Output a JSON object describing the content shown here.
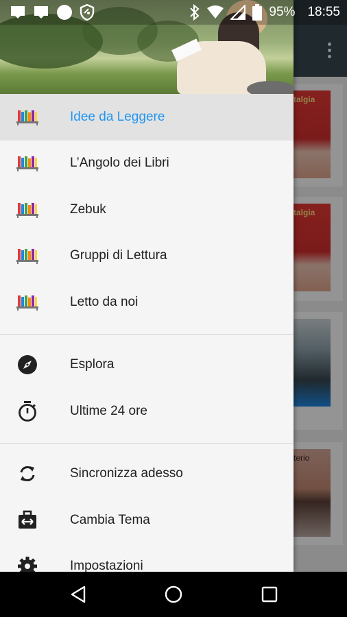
{
  "status_bar": {
    "battery": "95%",
    "time": "18:55",
    "icons": [
      "notification-icon",
      "notification-icon",
      "circle-icon",
      "shield-icon",
      "bluetooth-icon",
      "wifi-icon",
      "signal-icon",
      "battery-icon"
    ]
  },
  "background": {
    "covers": [
      {
        "text": "talgia",
        "style": "red"
      },
      {
        "text": "talgia",
        "style": "red"
      },
      {
        "text": "",
        "style": "blue"
      },
      {
        "text": "terio",
        "style": "brown"
      }
    ]
  },
  "drawer": {
    "feeds": [
      {
        "label": "Idee da Leggere",
        "icon": "bookshelf-icon",
        "active": true
      },
      {
        "label": "L’Angolo dei Libri",
        "icon": "bookshelf-icon",
        "active": false
      },
      {
        "label": "Zebuk",
        "icon": "bookshelf-icon",
        "active": false
      },
      {
        "label": "Gruppi di Lettura",
        "icon": "bookshelf-icon",
        "active": false
      },
      {
        "label": "Letto da noi",
        "icon": "bookshelf-icon",
        "active": false
      }
    ],
    "browse": [
      {
        "label": "Esplora",
        "icon": "compass-icon"
      },
      {
        "label": "Ultime 24 ore",
        "icon": "stopwatch-icon"
      }
    ],
    "actions": [
      {
        "label": "Sincronizza adesso",
        "icon": "sync-icon"
      },
      {
        "label": "Cambia Tema",
        "icon": "theme-swap-icon"
      },
      {
        "label": "Impostazioni",
        "icon": "gear-icon"
      }
    ]
  },
  "colors": {
    "accent": "#2196f3",
    "toolbar": "#37474f",
    "drawer_bg": "#f5f5f5",
    "active_bg": "#e2e2e2"
  }
}
